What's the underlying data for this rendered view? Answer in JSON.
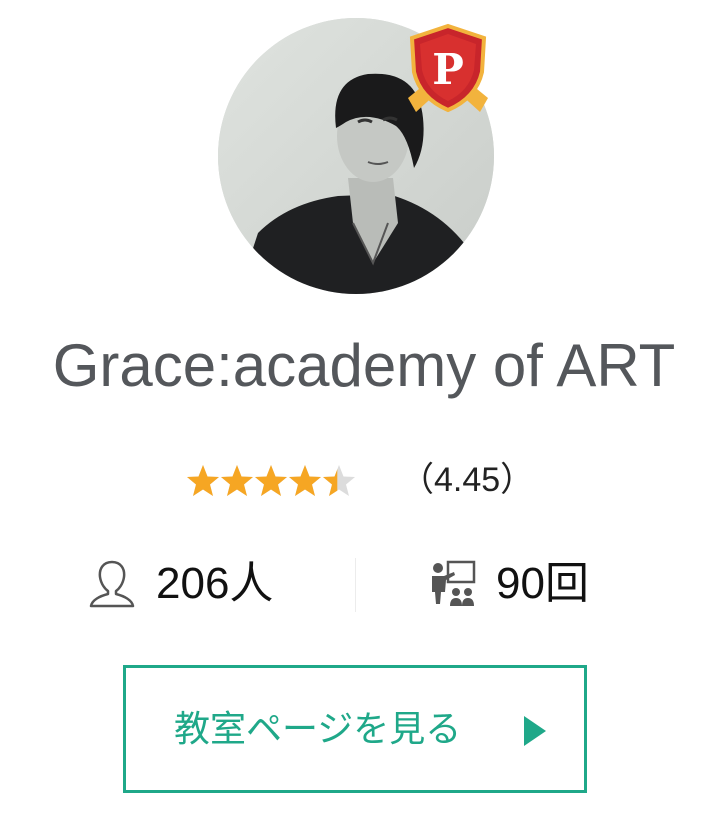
{
  "profile": {
    "name": "Grace:academy of ART",
    "badge_letter": "P"
  },
  "rating": {
    "stars": 4.45,
    "max_stars": 5,
    "value_text": "（4.45）"
  },
  "stats": {
    "students": "206人",
    "lessons": "90回"
  },
  "cta": {
    "label": "教室ページを見る"
  },
  "colors": {
    "accent": "#1fa889",
    "star_filled": "#f6a623",
    "star_empty": "#dcdcdc",
    "badge_red": "#c8252b",
    "badge_gold": "#f2b33d"
  },
  "icons": {
    "students": "person-outline-icon",
    "lessons": "teacher-board-icon",
    "badge": "premium-shield-icon",
    "arrow": "play-triangle-icon"
  }
}
